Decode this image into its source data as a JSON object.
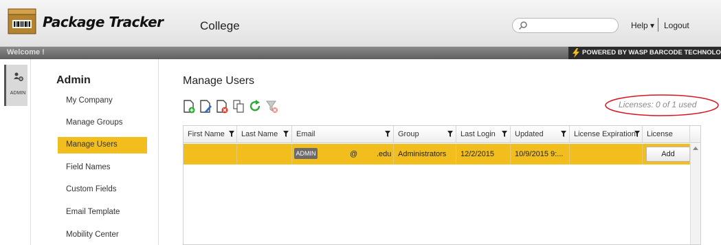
{
  "header": {
    "app_title": "Package Tracker",
    "org_name": "College",
    "search_placeholder": "",
    "help_label": "Help ▾",
    "logout_label": "Logout"
  },
  "welcome_bar": {
    "welcome_text": "Welcome !",
    "powered_by": "POWERED BY WASP BARCODE TECHNOLOGIES"
  },
  "rail": {
    "items": [
      {
        "label": "ADMIN",
        "icon": "admin-users-gear-icon"
      }
    ]
  },
  "sidebar": {
    "title": "Admin",
    "items": [
      {
        "label": "My Company",
        "active": false
      },
      {
        "label": "Manage Groups",
        "active": false
      },
      {
        "label": "Manage Users",
        "active": true
      },
      {
        "label": "Field Names",
        "active": false
      },
      {
        "label": "Custom Fields",
        "active": false
      },
      {
        "label": "Email Template",
        "active": false
      },
      {
        "label": "Mobility Center",
        "active": false
      }
    ]
  },
  "main": {
    "title": "Manage Users",
    "toolbar": [
      "add-user-icon",
      "edit-user-icon",
      "delete-user-icon",
      "copy-user-icon",
      "refresh-icon",
      "clear-filter-icon"
    ],
    "licenses": "Licenses: 0 of 1 used"
  },
  "grid": {
    "columns": [
      "First Name",
      "Last Name",
      "Email",
      "Group",
      "Last Login",
      "Updated",
      "License Expiration",
      "License"
    ],
    "rows": [
      {
        "first_name": "",
        "last_name": "",
        "badge": "ADMIN",
        "email_at": "@",
        "email_domain": ".edu",
        "group": "Administrators",
        "last_login": "12/2/2015",
        "updated": "10/9/2015 9:...",
        "license_expiration": "",
        "license_button": "Add"
      }
    ]
  },
  "colors": {
    "accent": "#f1be1e",
    "header_bg": "#e8e8e8",
    "welcome_bar": "#6e6e6e",
    "annotation_red": "#d9141c"
  }
}
